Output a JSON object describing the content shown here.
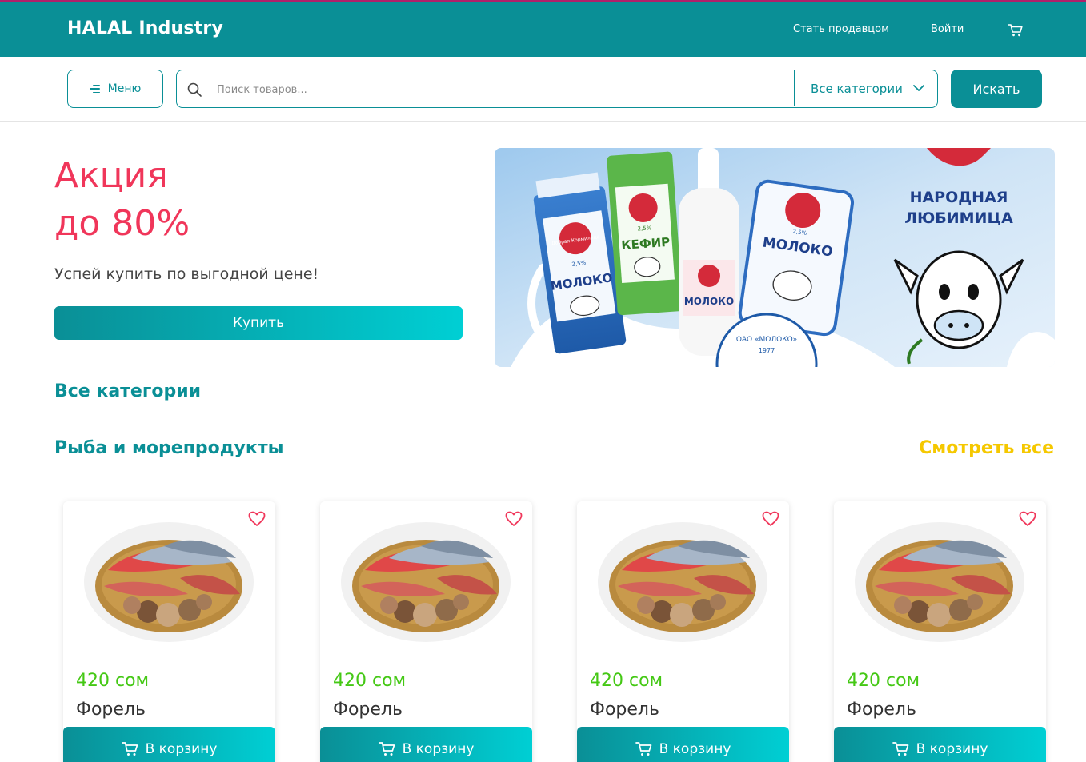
{
  "header": {
    "brand": "HALAL Industry",
    "become_seller": "Стать продавцом",
    "login": "Войти",
    "cart_icon": "cart-icon",
    "bar_color": "#0a8f96",
    "accent_top": "#b0206a"
  },
  "search": {
    "menu_label": "Меню",
    "placeholder": "Поиск товаров...",
    "value": "",
    "category_selected": "Все категории",
    "submit_label": "Искать"
  },
  "hero": {
    "title_line1": "Акция",
    "title_line2": "до 80%",
    "subtitle": "Успей купить по выгодной цене!",
    "cta": "Купить",
    "banner": {
      "headline_line1": "НАРОДНАЯ",
      "headline_line2": "ЛЮБИМИЦА",
      "pack1": "МОЛОКО",
      "pack2": "КЕФИР",
      "pack3": "МОЛОКО",
      "pack4": "МОЛОКО",
      "brand": "Добрая Кормилица",
      "fat": "2,5%",
      "seal": "ОАО «МОЛОКО»",
      "seal_year": "1977"
    }
  },
  "sections": {
    "all_categories": "Все категории",
    "fish_title": "Рыба и морепродукты",
    "see_all": "Смотреть все"
  },
  "products": [
    {
      "price": "420 сом",
      "name": "Форель",
      "button": "В корзину"
    },
    {
      "price": "420 сом",
      "name": "Форель",
      "button": "В корзину"
    },
    {
      "price": "420 сом",
      "name": "Форель",
      "button": "В корзину"
    },
    {
      "price": "420 сом",
      "name": "Форель",
      "button": "В корзину"
    }
  ],
  "colors": {
    "primary": "#0a8f96",
    "gradient_end": "#00cfd4",
    "promo": "#f0365a",
    "price": "#44c814",
    "see_all": "#f5c800",
    "heart": "#f0365a"
  }
}
